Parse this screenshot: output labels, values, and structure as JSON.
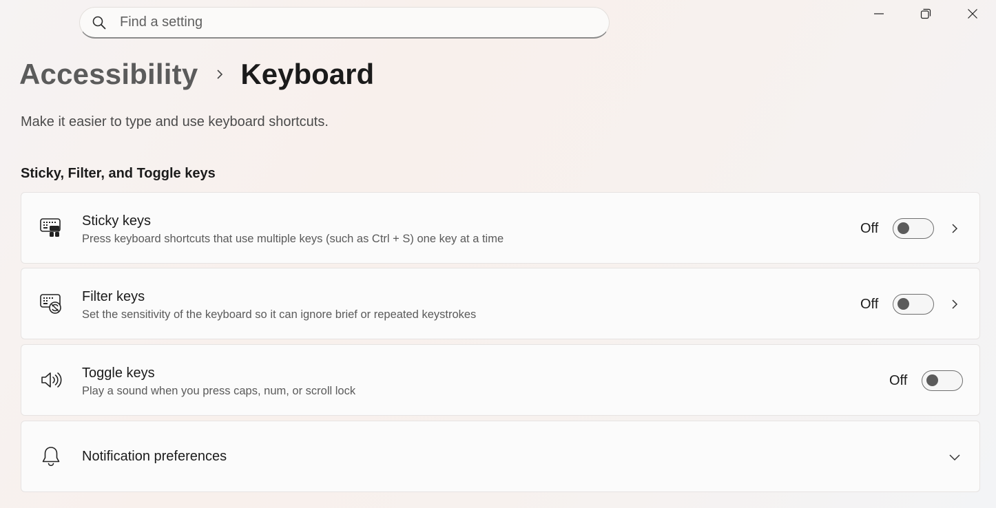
{
  "search": {
    "placeholder": "Find a setting"
  },
  "window_controls": {
    "minimize": "minimize-icon",
    "restore": "restore-icon",
    "close": "close-icon"
  },
  "header": {
    "parent": "Accessibility",
    "current": "Keyboard",
    "subtitle": "Make it easier to type and use keyboard shortcuts."
  },
  "section": {
    "title": "Sticky, Filter, and Toggle keys"
  },
  "cards": [
    {
      "icon": "sticky-keys-icon",
      "title": "Sticky keys",
      "desc": "Press keyboard shortcuts that use multiple keys (such as Ctrl + S) one key at a time",
      "state": "Off",
      "on": false
    },
    {
      "icon": "filter-keys-icon",
      "title": "Filter keys",
      "desc": "Set the sensitivity of the keyboard so it can ignore brief or repeated keystrokes",
      "state": "Off",
      "on": false
    },
    {
      "icon": "speaker-icon",
      "title": "Toggle keys",
      "desc": "Play a sound when you press caps, num, or scroll lock",
      "state": "Off",
      "on": false
    }
  ],
  "notification": {
    "icon": "bell-icon",
    "title": "Notification preferences"
  }
}
